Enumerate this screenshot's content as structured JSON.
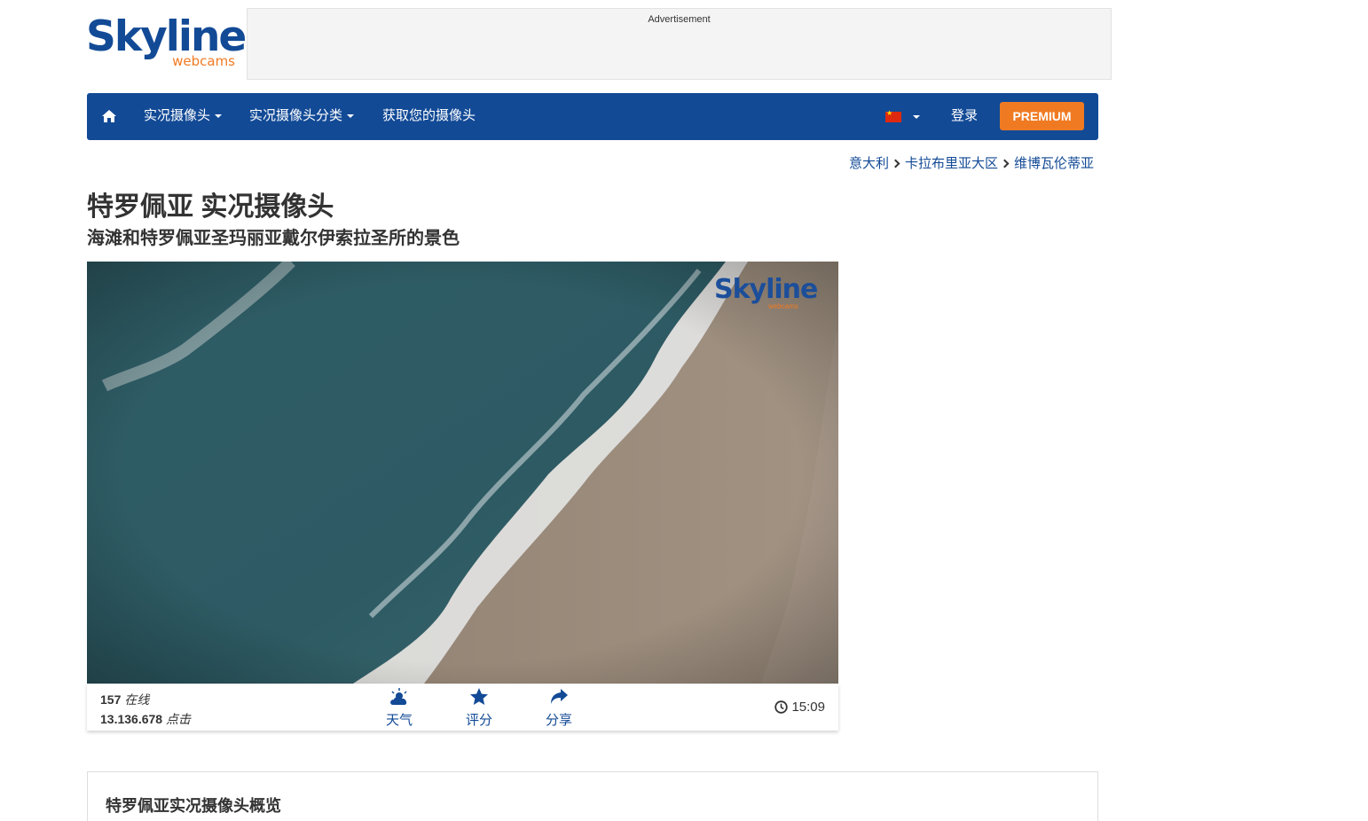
{
  "logo": {
    "word": "Skyline",
    "sub": "webcams"
  },
  "ad": {
    "label": "Advertisement"
  },
  "nav": {
    "home_icon": "home-icon",
    "items": [
      {
        "label": "实况摄像头"
      },
      {
        "label": "实况摄像头分类"
      },
      {
        "label": "获取您的摄像头"
      }
    ],
    "language_flag": "china-flag",
    "login": "登录",
    "premium": "PREMIUM"
  },
  "breadcrumb": [
    "意大利",
    "卡拉布里亚大区",
    "维博瓦伦蒂亚"
  ],
  "page": {
    "title": "特罗佩亚 实况摄像头",
    "subtitle": "海滩和特罗佩亚圣玛丽亚戴尔伊索拉圣所的景色"
  },
  "webcam": {
    "watermark": "Skyline",
    "watermark_sub": "webcams"
  },
  "stats": {
    "online_count": "157",
    "online_label": "在线",
    "clicks_count": "13.136.678",
    "clicks_label": "点击"
  },
  "actions": [
    {
      "label": "天气",
      "icon": "weather-icon"
    },
    {
      "label": "评分",
      "icon": "star-icon"
    },
    {
      "label": "分享",
      "icon": "share-icon"
    }
  ],
  "time": {
    "value": "15:09",
    "icon": "clock-icon"
  },
  "overview": {
    "title": "特罗佩亚实况摄像头概览"
  },
  "colors": {
    "brand_blue": "#124a96",
    "accent_orange": "#f07a22"
  }
}
